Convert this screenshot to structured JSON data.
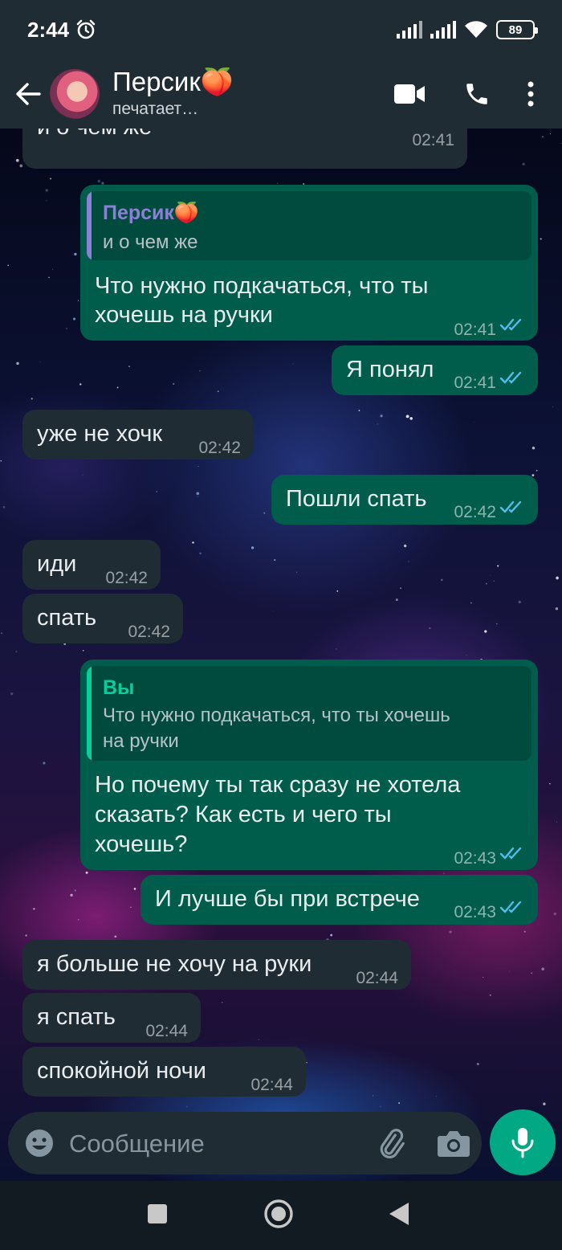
{
  "status_bar": {
    "time": "2:44",
    "battery": "89"
  },
  "header": {
    "contact_name": "Персик🍑",
    "contact_status": "печатает…"
  },
  "messages": [
    {
      "dir": "in",
      "text": "и о чем же",
      "time": "02:41"
    },
    {
      "dir": "out",
      "quote_author": "Персик🍑",
      "quote_text": "и о чем же",
      "text_lines": [
        "Что нужно подкачаться, что ты",
        "хочешь на ручки"
      ],
      "time": "02:41",
      "read": true
    },
    {
      "dir": "out",
      "text": "Я понял",
      "time": "02:41",
      "read": true
    },
    {
      "dir": "in",
      "text": "уже не хочк",
      "time": "02:42"
    },
    {
      "dir": "out",
      "text": "Пошли спать",
      "time": "02:42",
      "read": true
    },
    {
      "dir": "in",
      "text": "иди",
      "time": "02:42"
    },
    {
      "dir": "in",
      "text": "спать",
      "time": "02:42"
    },
    {
      "dir": "out",
      "quote_author": "Вы",
      "quote_text_lines": [
        "Что нужно подкачаться, что ты хочешь",
        "на ручки"
      ],
      "text_lines": [
        "Но почему ты так сразу не хотела",
        "сказать? Как есть и чего ты",
        "хочешь?"
      ],
      "time": "02:43",
      "read": true
    },
    {
      "dir": "out",
      "text": "И лучше бы при встрече",
      "time": "02:43",
      "read": true
    },
    {
      "dir": "in",
      "text": "я больше не хочу на руки",
      "time": "02:44"
    },
    {
      "dir": "in",
      "text": "я спать",
      "time": "02:44"
    },
    {
      "dir": "in",
      "text": "спокойной ночи",
      "time": "02:44"
    }
  ],
  "composer": {
    "placeholder": "Сообщение"
  },
  "colors": {
    "incoming": "#1f2c33",
    "outgoing": "#005c4b",
    "accent": "#00a884",
    "read_ticks": "#53bdeb",
    "quote_contact": "#8b7fd6",
    "quote_self": "#06cf9c"
  },
  "icons": [
    "back-arrow-icon",
    "video-call-icon",
    "phone-icon",
    "more-vert-icon",
    "emoji-icon",
    "attach-icon",
    "camera-icon",
    "mic-icon",
    "alarm-icon",
    "signal-icon",
    "wifi-icon",
    "battery-icon",
    "nav-recents-icon",
    "nav-home-icon",
    "nav-back-icon"
  ]
}
